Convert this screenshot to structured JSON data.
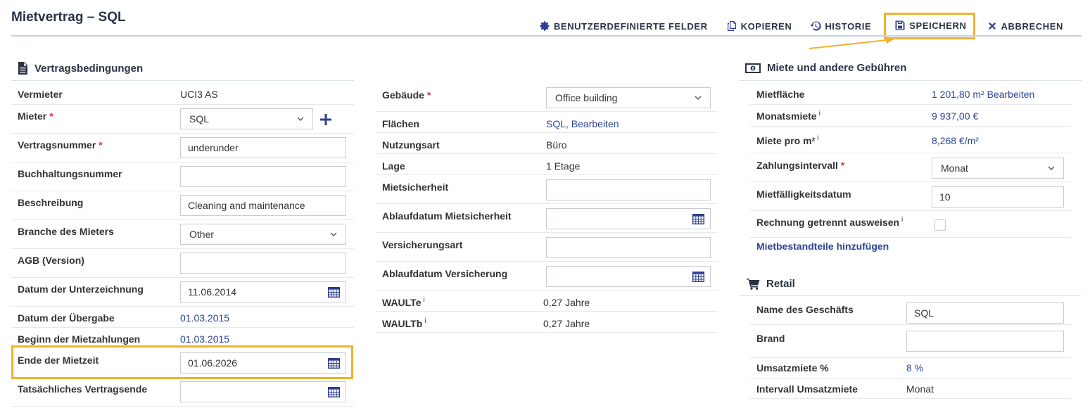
{
  "page_title": "Mietvertrag – SQL",
  "toolbar": {
    "custom_fields": "BENUTZERDEFINIERTE FELDER",
    "copy": "KOPIEREN",
    "history": "HISTORIE",
    "save": "SPEICHERN",
    "cancel": "ABBRECHEN"
  },
  "contract": {
    "title": "Vertragsbedingungen",
    "landlord": {
      "label": "Vermieter",
      "value": "UCI3 AS"
    },
    "tenant": {
      "label": "Mieter",
      "required": "*",
      "value": "SQL"
    },
    "contract_number": {
      "label": "Vertragsnummer",
      "required": "*",
      "value": "underunder"
    },
    "accounting_number": {
      "label": "Buchhaltungsnummer",
      "value": ""
    },
    "description": {
      "label": "Beschreibung",
      "value": "Cleaning and maintenance"
    },
    "tenant_industry": {
      "label": "Branche des Mieters",
      "value": "Other"
    },
    "terms_version": {
      "label": "AGB (Version)",
      "value": ""
    },
    "signing_date": {
      "label": "Datum der Unterzeichnung",
      "value": "11.06.2014"
    },
    "handover_date": {
      "label": "Datum der Übergabe",
      "value": "01.03.2015"
    },
    "rent_start": {
      "label": "Beginn der Mietzahlungen",
      "value": "01.03.2015"
    },
    "lease_end": {
      "label": "Ende der Mietzeit",
      "value": "01.06.2026"
    },
    "actual_end": {
      "label": "Tatsächliches Vertragsende",
      "value": ""
    }
  },
  "building": {
    "building": {
      "label": "Gebäude",
      "required": "*",
      "value": "Office building"
    },
    "areas": {
      "label": "Flächen",
      "value": "SQL",
      "sep": ",",
      "edit": "Bearbeiten"
    },
    "usage": {
      "label": "Nutzungsart",
      "value": "Büro"
    },
    "location": {
      "label": "Lage",
      "value": "1 Etage"
    },
    "deposit": {
      "label": "Mietsicherheit",
      "value": ""
    },
    "deposit_expiry": {
      "label": "Ablaufdatum Mietsicherheit",
      "value": ""
    },
    "insurance_type": {
      "label": "Versicherungsart",
      "value": ""
    },
    "insurance_expiry": {
      "label": "Ablaufdatum Versicherung",
      "value": ""
    },
    "walte": {
      "label": "WAULTe",
      "sup": "i",
      "value": "0,27 Jahre"
    },
    "waultb": {
      "label": "WAULTb",
      "sup": "i",
      "value": "0,27 Jahre"
    }
  },
  "rent": {
    "title": "Miete und andere Gebühren",
    "area": {
      "label": "Mietfläche",
      "value": "1 201,80 m² Bearbeiten"
    },
    "monthly_rent": {
      "label": "Monatsmiete",
      "sup": "i",
      "value": "9 937,00 €"
    },
    "rent_per_m2": {
      "label": "Miete pro m²",
      "sup": "i",
      "value": "8,268 €/m²"
    },
    "interval": {
      "label": "Zahlungsintervall",
      "required": "*",
      "value": "Monat"
    },
    "due_date": {
      "label": "Mietfälligkeitsdatum",
      "value": "10"
    },
    "separate_invoice": {
      "label": "Rechnung getrennt ausweisen",
      "sup": "i"
    },
    "add_components": "Mietbestandteile hinzufügen"
  },
  "retail": {
    "title": "Retail",
    "shop_name": {
      "label": "Name des Geschäfts",
      "value": "SQL"
    },
    "brand": {
      "label": "Brand",
      "value": ""
    },
    "turnover_rent": {
      "label": "Umsatzmiete %",
      "value": "8 %"
    },
    "turnover_interval": {
      "label": "Intervall Umsatzmiete",
      "value": "Monat"
    }
  },
  "colors": {
    "accent": "#2d4595",
    "highlight": "#f0b12f",
    "required": "#d43a3a"
  }
}
